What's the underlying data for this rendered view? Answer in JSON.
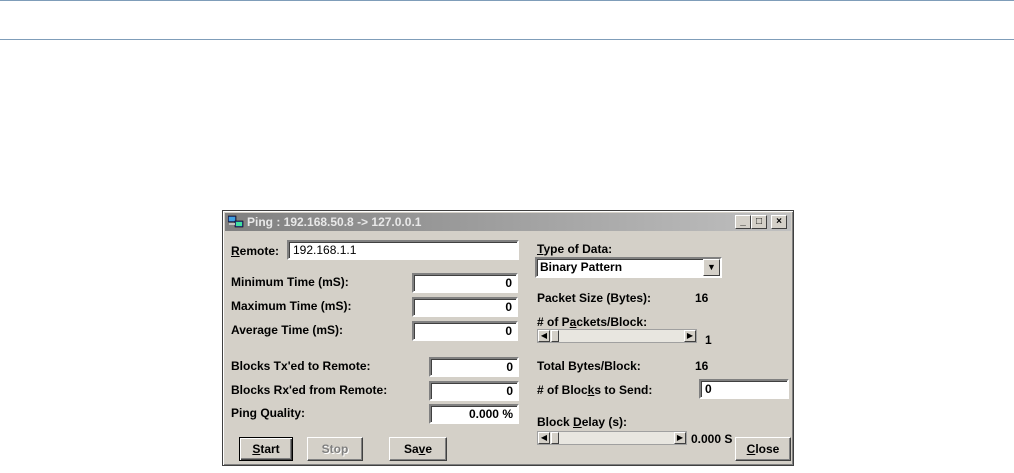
{
  "window": {
    "title": "Ping : 192.168.50.8 -> 127.0.0.1",
    "minimize": "_",
    "maximize": "□",
    "close": "×"
  },
  "left": {
    "remote": {
      "label_pre": "",
      "label_u": "R",
      "label_post": "emote:",
      "value": "192.168.1.1"
    },
    "min_time": {
      "label": "Minimum Time (mS):",
      "value": "0"
    },
    "max_time": {
      "label": "Maximum Time (mS):",
      "value": "0"
    },
    "avg_time": {
      "label": "Average Time (mS):",
      "value": "0"
    },
    "blocks_tx": {
      "label": "Blocks Tx'ed to Remote:",
      "value": "0"
    },
    "blocks_rx": {
      "label": "Blocks Rx'ed from Remote:",
      "value": "0"
    },
    "ping_quality": {
      "label": "Ping Quality:",
      "value": "0.000 %"
    }
  },
  "right": {
    "type_of_data": {
      "label_u": "T",
      "label_post": "ype of Data:",
      "selected": "Binary Pattern"
    },
    "packet_size": {
      "label": "Packet Size (Bytes):",
      "value": "16"
    },
    "packets_per_block": {
      "label_pre": "# of P",
      "label_u": "a",
      "label_post": "ckets/Block:",
      "value": "1"
    },
    "total_bytes": {
      "label": "Total Bytes/Block:",
      "value": "16"
    },
    "blocks_to_send": {
      "label_pre": "# of Bloc",
      "label_u": "k",
      "label_post": "s to Send:",
      "value": "0"
    },
    "block_delay": {
      "label_pre": "Block ",
      "label_u": "D",
      "label_post": "elay (s):",
      "value": "0.000 S"
    }
  },
  "buttons": {
    "start": {
      "u": "S",
      "rest": "tart"
    },
    "stop": {
      "label": "Stop"
    },
    "save": {
      "pre": "Sa",
      "u": "v",
      "post": "e"
    },
    "close": {
      "u": "C",
      "rest": "lose"
    }
  }
}
